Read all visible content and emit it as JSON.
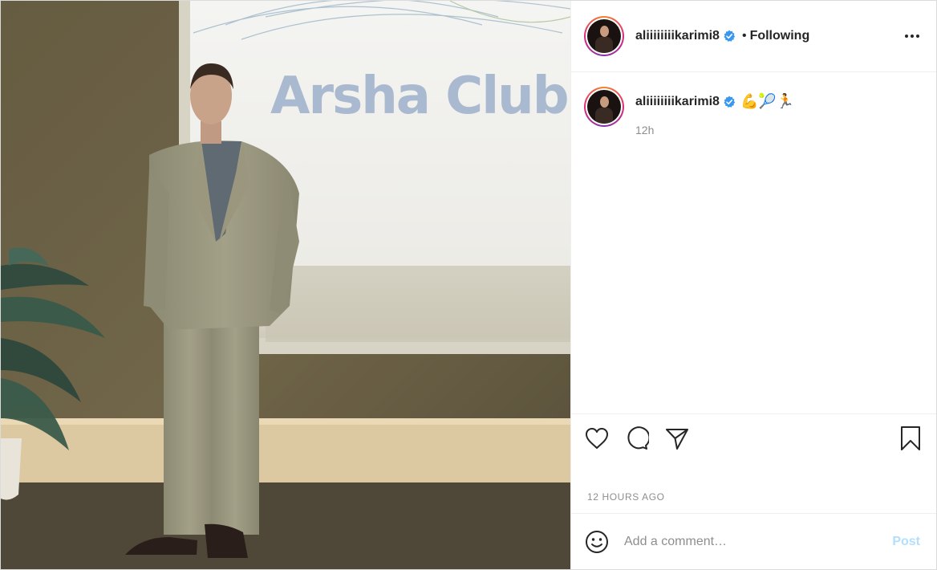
{
  "post": {
    "username": "aliiiiiiiikarimi8",
    "separator": "•",
    "follow_status": "Following",
    "caption_emojis": "💪🎾🏃",
    "caption_time": "12h",
    "timestamp": "12 HOURS AGO"
  },
  "photo": {
    "sign_text": "Arsha Club"
  },
  "comment_box": {
    "placeholder": "Add a comment…",
    "post_label": "Post"
  },
  "icons": {
    "more": "more-options-icon",
    "like": "heart-icon",
    "comment": "comment-bubble-icon",
    "share": "paper-plane-icon",
    "save": "bookmark-icon",
    "emoji": "smiley-icon",
    "verified": "verified-badge-icon"
  },
  "colors": {
    "verified": "#3897f0",
    "post_button_disabled": "#b2dffc",
    "text_primary": "#262626",
    "text_secondary": "#8e8e8e"
  }
}
